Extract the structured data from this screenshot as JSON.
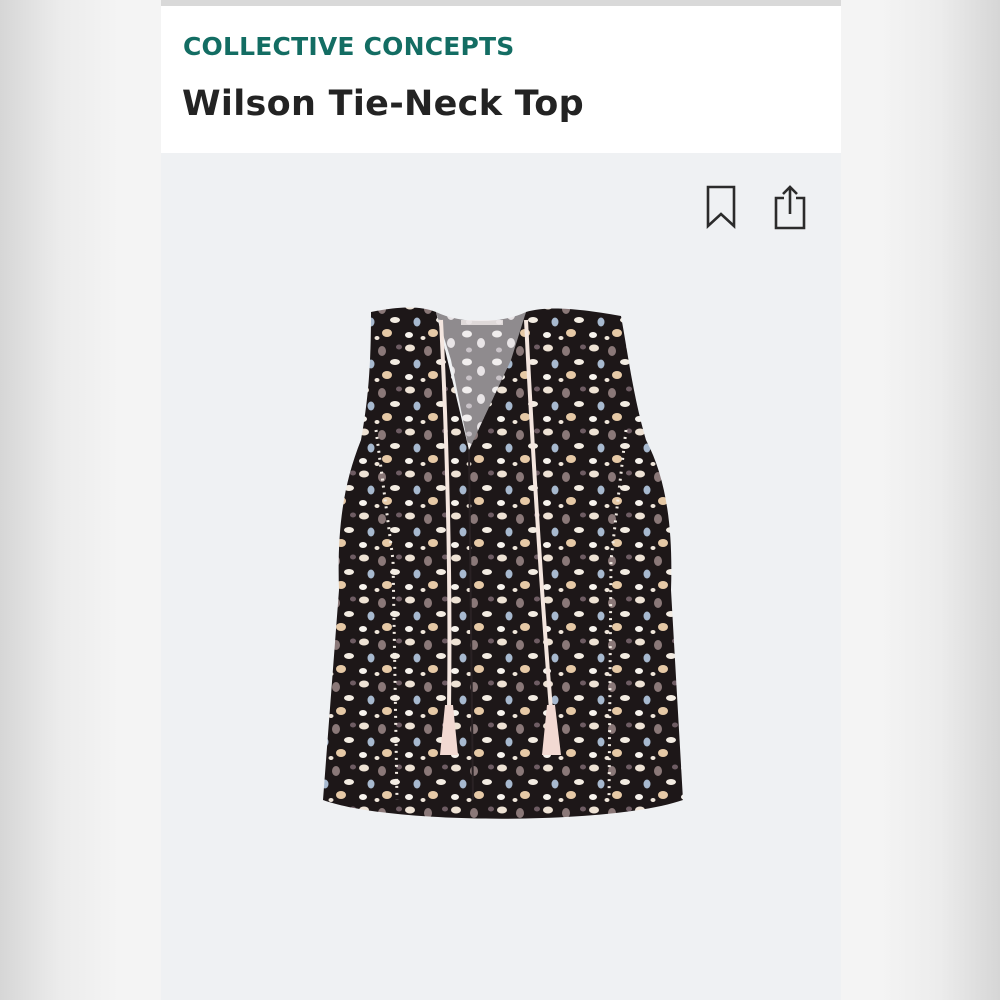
{
  "header": {
    "brand": "COLLECTIVE CONCEPTS",
    "product_name": "Wilson Tie-Neck Top"
  },
  "actions": {
    "bookmark_icon": "bookmark-icon",
    "share_icon": "share-icon"
  },
  "product_image": {
    "description_icon": "sleeveless-top-illustration"
  },
  "colors": {
    "brand": "#136d63",
    "title": "#232323",
    "card_background": "#eff1f3",
    "garment": "#1d1718"
  }
}
